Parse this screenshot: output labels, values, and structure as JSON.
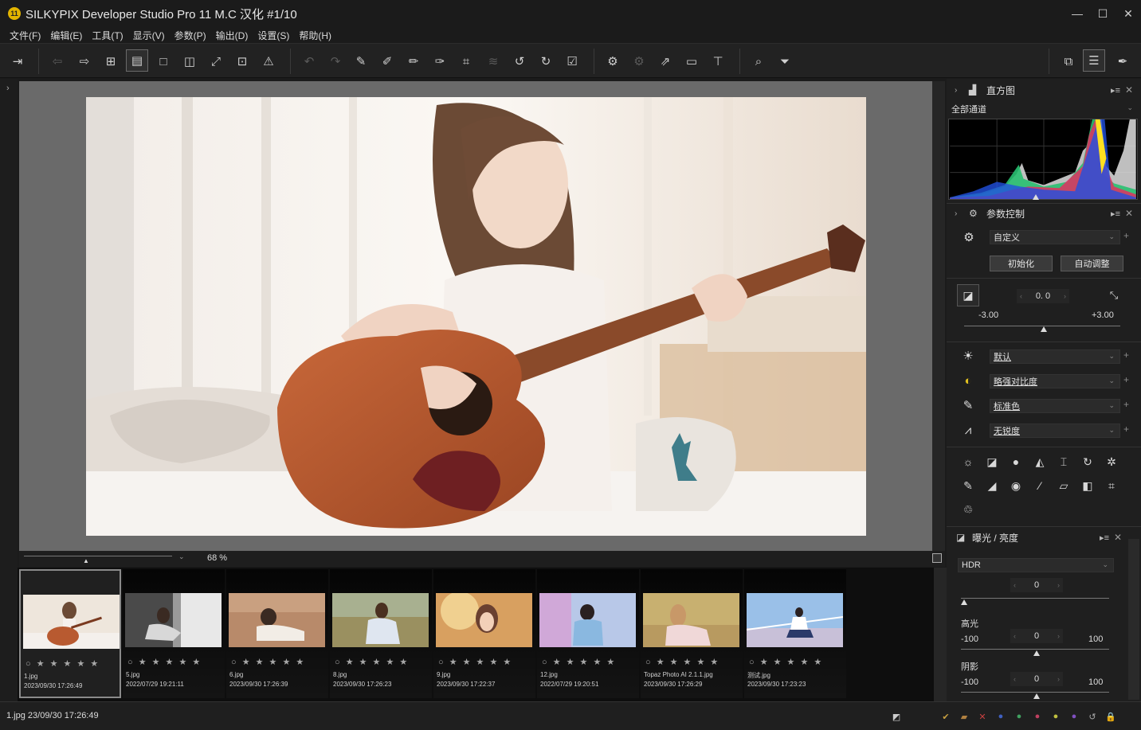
{
  "window": {
    "title": "SILKYPIX Developer Studio Pro 11 M.C 汉化   #1/10",
    "logo": "app-logo-icon",
    "controls": [
      "minimize",
      "maximize",
      "close"
    ]
  },
  "menu": [
    {
      "label": "文件(F)"
    },
    {
      "label": "编辑(E)"
    },
    {
      "label": "工具(T)"
    },
    {
      "label": "显示(V)"
    },
    {
      "label": "参数(P)"
    },
    {
      "label": "输出(D)"
    },
    {
      "label": "设置(S)"
    },
    {
      "label": "帮助(H)"
    }
  ],
  "toolbar_icons": [
    "import-icon",
    "back-icon",
    "forward-icon",
    "grid-view-icon",
    "filmstrip-view-icon",
    "single-view-icon",
    "compare-view-icon",
    "fullscreen-icon",
    "grid-overlay-icon",
    "warning-icon",
    "undo-icon",
    "redo-icon",
    "copy-params-icon",
    "paste-params-icon",
    "stamp-icon",
    "clear-params-icon",
    "crop-tool-icon",
    "stack-icon",
    "rotate-left-icon",
    "rotate-right-icon",
    "mark-icon",
    "develop-icon",
    "batch-develop-icon",
    "export-icon",
    "screen-icon",
    "print-icon",
    "search-icon",
    "filter-icon",
    "window-layout-icon",
    "control-panel-icon",
    "pen-icon"
  ],
  "viewer": {
    "zoom_value": "68 %"
  },
  "filmstrip": [
    {
      "name": "1.jpg",
      "date": "2023/09/30 17:26:49",
      "selected": true
    },
    {
      "name": "5.jpg",
      "date": "2022/07/29 19:21:11",
      "selected": false
    },
    {
      "name": "6.jpg",
      "date": "2023/09/30 17:26:39",
      "selected": false
    },
    {
      "name": "8.jpg",
      "date": "2023/09/30 17:26:23",
      "selected": false
    },
    {
      "name": "9.jpg",
      "date": "2023/09/30 17:22:37",
      "selected": false
    },
    {
      "name": "12.jpg",
      "date": "2022/07/29 19:20:51",
      "selected": false
    },
    {
      "name": "Topaz Photo AI 2.1.1.jpg",
      "date": "2023/09/30 17:26:29",
      "selected": false
    },
    {
      "name": "测试.jpg",
      "date": "2023/09/30 17:23:23",
      "selected": false
    }
  ],
  "thumb_stars": "○ ★ ★ ★ ★ ★",
  "status": {
    "text": "1.jpg 23/09/30 17:26:49"
  },
  "histogram": {
    "title": "直方图",
    "channel": "全部通道"
  },
  "params": {
    "title": "参数控制",
    "preset": "自定义",
    "reset_label": "初始化",
    "auto_label": "自动调整",
    "exposure_value": "0. 0",
    "min": "-3.00",
    "max": "+3.00",
    "rows": [
      {
        "icon": "white-balance-icon",
        "value": "默认"
      },
      {
        "icon": "contrast-icon",
        "value": "略强对比度"
      },
      {
        "icon": "color-icon",
        "value": "标准色"
      },
      {
        "icon": "sharpness-icon",
        "value": "无锐度"
      }
    ]
  },
  "exposure_panel": {
    "title": "曝光 / 亮度",
    "mode": "HDR",
    "hdr_value": "0",
    "highlight_label": "高光",
    "highlight_min": "-100",
    "highlight_value": "0",
    "highlight_max": "100",
    "shadow_label": "阴影",
    "shadow_min": "-100",
    "shadow_value": "0",
    "shadow_max": "100"
  },
  "colors": {
    "accent_yellow": "#e2b400",
    "panel_bg": "#1f1f1f",
    "viewer_bg": "#6a6a6a"
  }
}
